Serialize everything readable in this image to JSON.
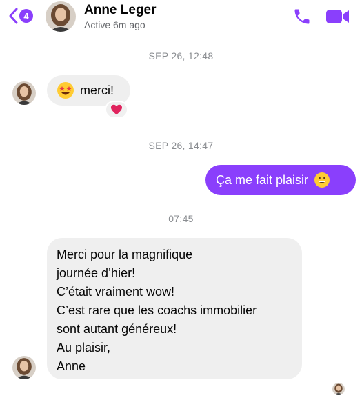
{
  "header": {
    "back_badge": "4",
    "contact_name": "Anne Leger",
    "status": "Active 6m ago"
  },
  "messages": [
    {
      "timestamp": "SEP 26, 12:48",
      "direction": "incoming",
      "emoji": "star-struck-emoji",
      "text": "merci!",
      "reaction": "red-heart"
    },
    {
      "timestamp": "SEP 26, 14:47",
      "direction": "outgoing",
      "text": "Ça me fait plaisir",
      "emoji": "grinning-face-emoji"
    },
    {
      "timestamp": "07:45",
      "direction": "incoming",
      "lines": [
        "Merci pour la magnifique",
        "journée d’hier!",
        "C’était vraiment wow!",
        "C’est rare que les coachs immobilier",
        "sont autant généreux!",
        "Au plaisir,",
        "Anne"
      ]
    }
  ],
  "colors": {
    "accent": "#8a3ffc",
    "incoming_bubble": "#efefef",
    "timestamp": "#8a8d91",
    "status": "#65676b"
  }
}
